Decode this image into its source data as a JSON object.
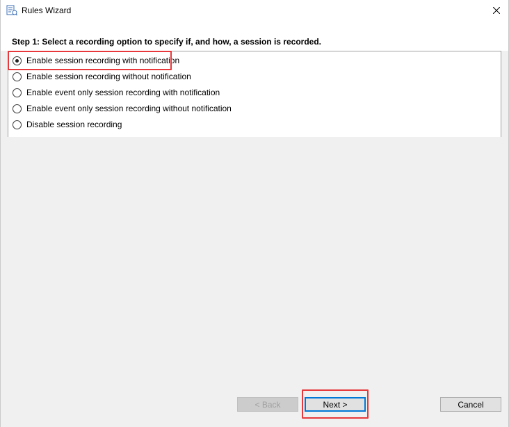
{
  "window": {
    "title": "Rules Wizard"
  },
  "icons": {
    "app": "rules-wizard-icon",
    "close": "close-icon"
  },
  "step": {
    "title": "Step 1: Select a recording option to specify if, and how, a session is recorded."
  },
  "options": [
    {
      "label": "Enable session recording with notification",
      "checked": true
    },
    {
      "label": "Enable session recording without notification",
      "checked": false
    },
    {
      "label": "Enable event only session recording with notification",
      "checked": false
    },
    {
      "label": "Enable event only session recording without notification",
      "checked": false
    },
    {
      "label": "Disable session recording",
      "checked": false
    }
  ],
  "buttons": {
    "back": "< Back",
    "next": "Next >",
    "cancel": "Cancel"
  },
  "colors": {
    "highlight": "#e8383b",
    "default_button_border": "#0078d7"
  }
}
